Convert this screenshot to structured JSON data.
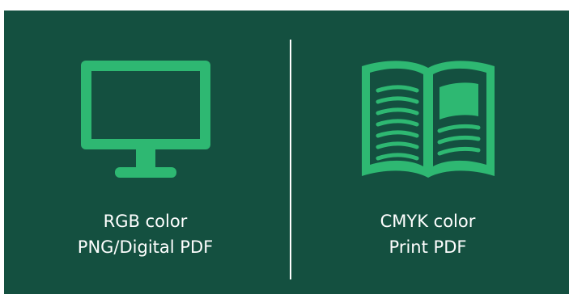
{
  "colors": {
    "background": "#145040",
    "accent": "#2eb872",
    "text": "#ffffff",
    "divider": "#ffffff"
  },
  "left_panel": {
    "icon": "monitor-icon",
    "line1": "RGB color",
    "line2": "PNG/Digital PDF"
  },
  "right_panel": {
    "icon": "open-book-icon",
    "line1": "CMYK color",
    "line2": "Print PDF"
  }
}
